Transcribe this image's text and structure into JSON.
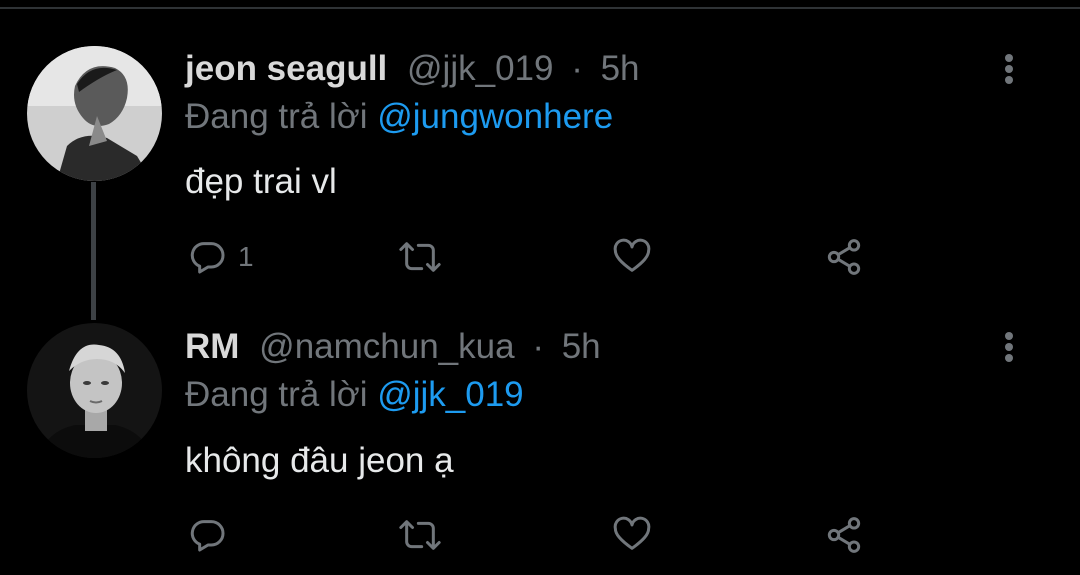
{
  "tweets": [
    {
      "author_name": "jeon seagull",
      "handle": "@jjk_019",
      "separator": "·",
      "time": "5h",
      "reply_prefix": "Đang trả lời",
      "reply_to": "@jungwonhere",
      "text": "đẹp trai vl",
      "reply_count": "1",
      "avatar": "avatar-jeon-seagull"
    },
    {
      "author_name": "RM",
      "handle": "@namchun_kua",
      "separator": "·",
      "time": "5h",
      "reply_prefix": "Đang trả lời",
      "reply_to": "@jjk_019",
      "text": "không đâu jeon ạ",
      "reply_count": "",
      "avatar": "avatar-rm"
    }
  ],
  "icons": [
    "reply-icon",
    "retweet-icon",
    "like-icon",
    "share-icon",
    "more-options-icon"
  ],
  "colors": {
    "background": "#000000",
    "accent": "#1d9bf0",
    "muted": "#71767b",
    "text": "#e7e9ea"
  }
}
